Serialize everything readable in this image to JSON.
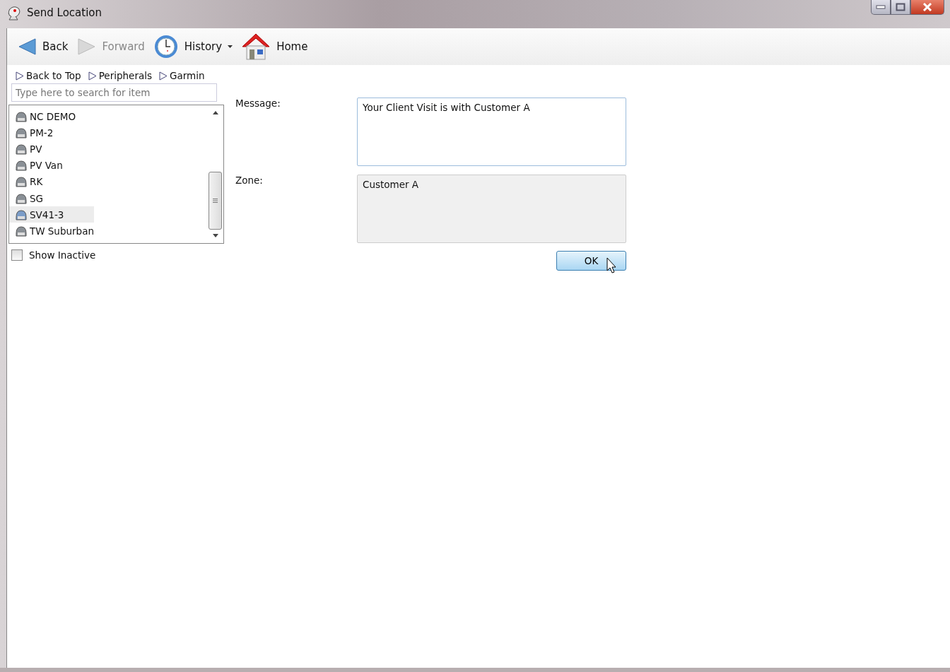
{
  "window": {
    "title": "Send Location"
  },
  "toolbar": [
    {
      "kind": "back",
      "label": "Back",
      "disabled": false
    },
    {
      "kind": "forward",
      "label": "Forward",
      "disabled": true
    },
    {
      "kind": "history",
      "label": "History",
      "disabled": false
    },
    {
      "kind": "home",
      "label": "Home",
      "disabled": false
    }
  ],
  "breadcrumbs": [
    "Back to Top",
    "Peripherals",
    "Garmin"
  ],
  "search": {
    "placeholder": "Type here to search for item"
  },
  "vehicles": [
    {
      "name": "NC DEMO",
      "selected": false
    },
    {
      "name": "PM-2",
      "selected": false
    },
    {
      "name": "PV",
      "selected": false
    },
    {
      "name": "PV Van",
      "selected": false
    },
    {
      "name": "RK",
      "selected": false
    },
    {
      "name": "SG",
      "selected": false
    },
    {
      "name": "SV41-3",
      "selected": true
    },
    {
      "name": "TW Suburban",
      "selected": false
    }
  ],
  "show_inactive": {
    "label": "Show Inactive",
    "checked": false
  },
  "form": [
    {
      "label": "Message:",
      "value": "Your Client Visit is with Customer A",
      "disabled": false
    },
    {
      "label": "Zone:",
      "value": "Customer A",
      "disabled": true
    }
  ],
  "ok_button": "OK"
}
